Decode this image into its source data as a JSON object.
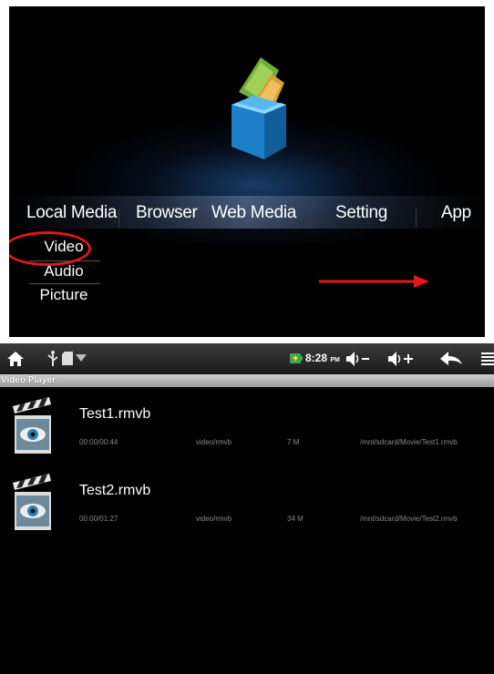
{
  "launcher": {
    "menu": [
      "Local Media",
      "Browser",
      "Web Media",
      "Setting",
      "App"
    ],
    "submenu": [
      "Video",
      "Audio",
      "Picture"
    ],
    "highlighted": "Video",
    "annotation_color": "#e0181c"
  },
  "player": {
    "status": {
      "time": "8:28",
      "ampm": "PM",
      "icons": [
        "home-icon",
        "usb-icon",
        "sd-card-icon",
        "wifi-icon",
        "battery-icon",
        "volume-down-icon",
        "volume-up-icon",
        "back-icon",
        "menu-icon"
      ]
    },
    "title": "Video Player",
    "files": [
      {
        "name": "Test1.rmvb",
        "duration": "00:00/00:44",
        "type": "video/rmvb",
        "size": "7 M",
        "path": "/mnt/sdcard/Movie/Test1.rmvb"
      },
      {
        "name": "Test2.rmvb",
        "duration": "00:00/01:27",
        "type": "video/rmvb",
        "size": "34 M",
        "path": "/mnt/sdcard/Movie/Test2.rmvb"
      }
    ]
  }
}
